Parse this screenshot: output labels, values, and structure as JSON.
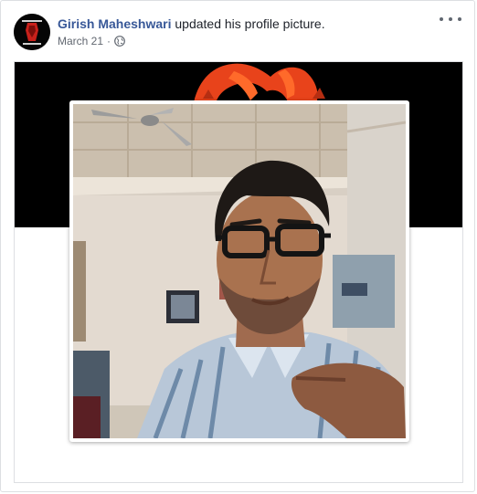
{
  "post": {
    "author": "Girish Maheshwari",
    "action": "updated his profile picture.",
    "date": "March 21",
    "separator": "·",
    "privacy_icon": "globe-icon",
    "menu_icon": "more-options-icon"
  },
  "colors": {
    "author_link": "#385898",
    "meta_text": "#616770",
    "border": "#dddfe2",
    "cover_background": "#000000",
    "cover_accent": "#e8431b"
  }
}
